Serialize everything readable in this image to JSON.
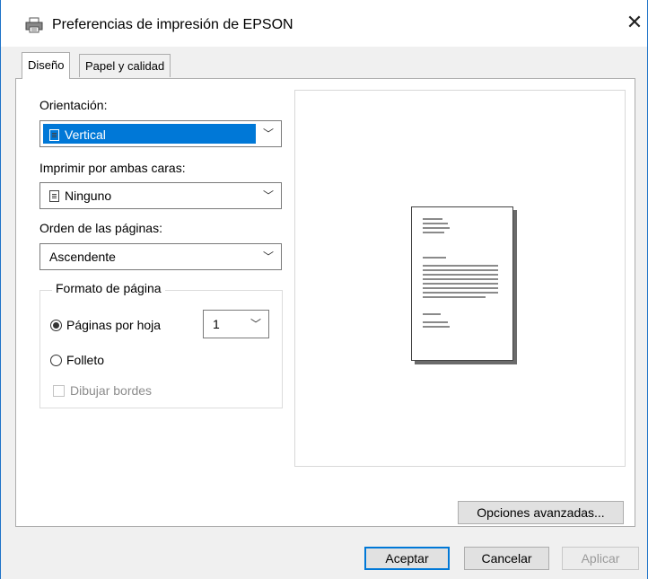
{
  "window": {
    "title": "Preferencias de impresión de EPSON",
    "close_label": "✕"
  },
  "tabs": [
    {
      "label": "Diseño",
      "active": true
    },
    {
      "label": "Papel y calidad",
      "active": false
    }
  ],
  "orientation": {
    "label": "Orientación:",
    "value": "Vertical"
  },
  "duplex": {
    "label": "Imprimir por ambas caras:",
    "value": "Ninguno"
  },
  "page_order": {
    "label": "Orden de las páginas:",
    "value": "Ascendente"
  },
  "page_format": {
    "group_label": "Formato de página",
    "pages_per_sheet_label": "Páginas por hoja",
    "pages_per_sheet_value": "1",
    "booklet_label": "Folleto",
    "draw_borders_label": "Dibujar bordes",
    "selected": "pages_per_sheet",
    "draw_borders_checked": false
  },
  "buttons": {
    "advanced": "Opciones avanzadas...",
    "ok": "Aceptar",
    "cancel": "Cancelar",
    "apply": "Aplicar"
  },
  "colors": {
    "selection": "#0078d7",
    "border_accent": "#1e73c8"
  },
  "icons": {
    "title": "printer-icon",
    "orientation": "portrait-page-icon",
    "duplex": "page-icon",
    "dropdown": "chevron-down-icon"
  }
}
